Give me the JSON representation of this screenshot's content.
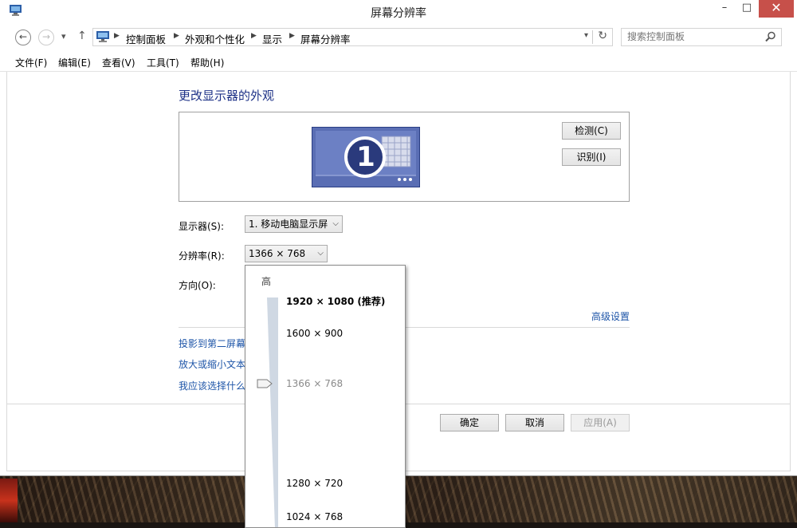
{
  "window": {
    "title": "屏幕分辨率"
  },
  "window_controls": {
    "minimize": "–",
    "maximize": "□",
    "close": "✕"
  },
  "nav": {
    "back_icon": "←",
    "forward_icon": "→",
    "recent_icon": "▾",
    "up_icon": "↑",
    "breadcrumb": [
      "控制面板",
      "外观和个性化",
      "显示",
      "屏幕分辨率"
    ],
    "refresh_icon": "↻",
    "dropdown_icon": "▾"
  },
  "search": {
    "placeholder": "搜索控制面板"
  },
  "menu": [
    "文件(F)",
    "编辑(E)",
    "查看(V)",
    "工具(T)",
    "帮助(H)"
  ],
  "main": {
    "heading": "更改显示器的外观",
    "monitor_number": "1",
    "detect_button": "检测(C)",
    "identify_button": "识别(I)",
    "display_label": "显示器(S):",
    "display_value": "1. 移动电脑显示屏",
    "resolution_label": "分辨率(R):",
    "resolution_value": "1366 × 768",
    "orientation_label": "方向(O):",
    "advanced_link": "高级设置",
    "links": [
      "投影到第二屏幕",
      "放大或缩小文本",
      "我应该选择什么"
    ]
  },
  "footer": {
    "ok": "确定",
    "cancel": "取消",
    "apply": "应用(A)"
  },
  "resolution_dropdown": {
    "high_label": "高",
    "options": [
      {
        "label": "1920 × 1080 (推荐)",
        "style": "recommended"
      },
      {
        "label": "1600 × 900",
        "style": "normal"
      },
      {
        "label": "1366 × 768",
        "style": "current"
      },
      {
        "label": "1280 × 720",
        "style": "normal"
      },
      {
        "label": "1024 × 768",
        "style": "normal"
      }
    ],
    "selected_value": "1366 × 768"
  },
  "colors": {
    "heading": "#1e3287",
    "link": "#1e55a8",
    "close": "#c7504a",
    "monitor": "#5a6eb4"
  }
}
